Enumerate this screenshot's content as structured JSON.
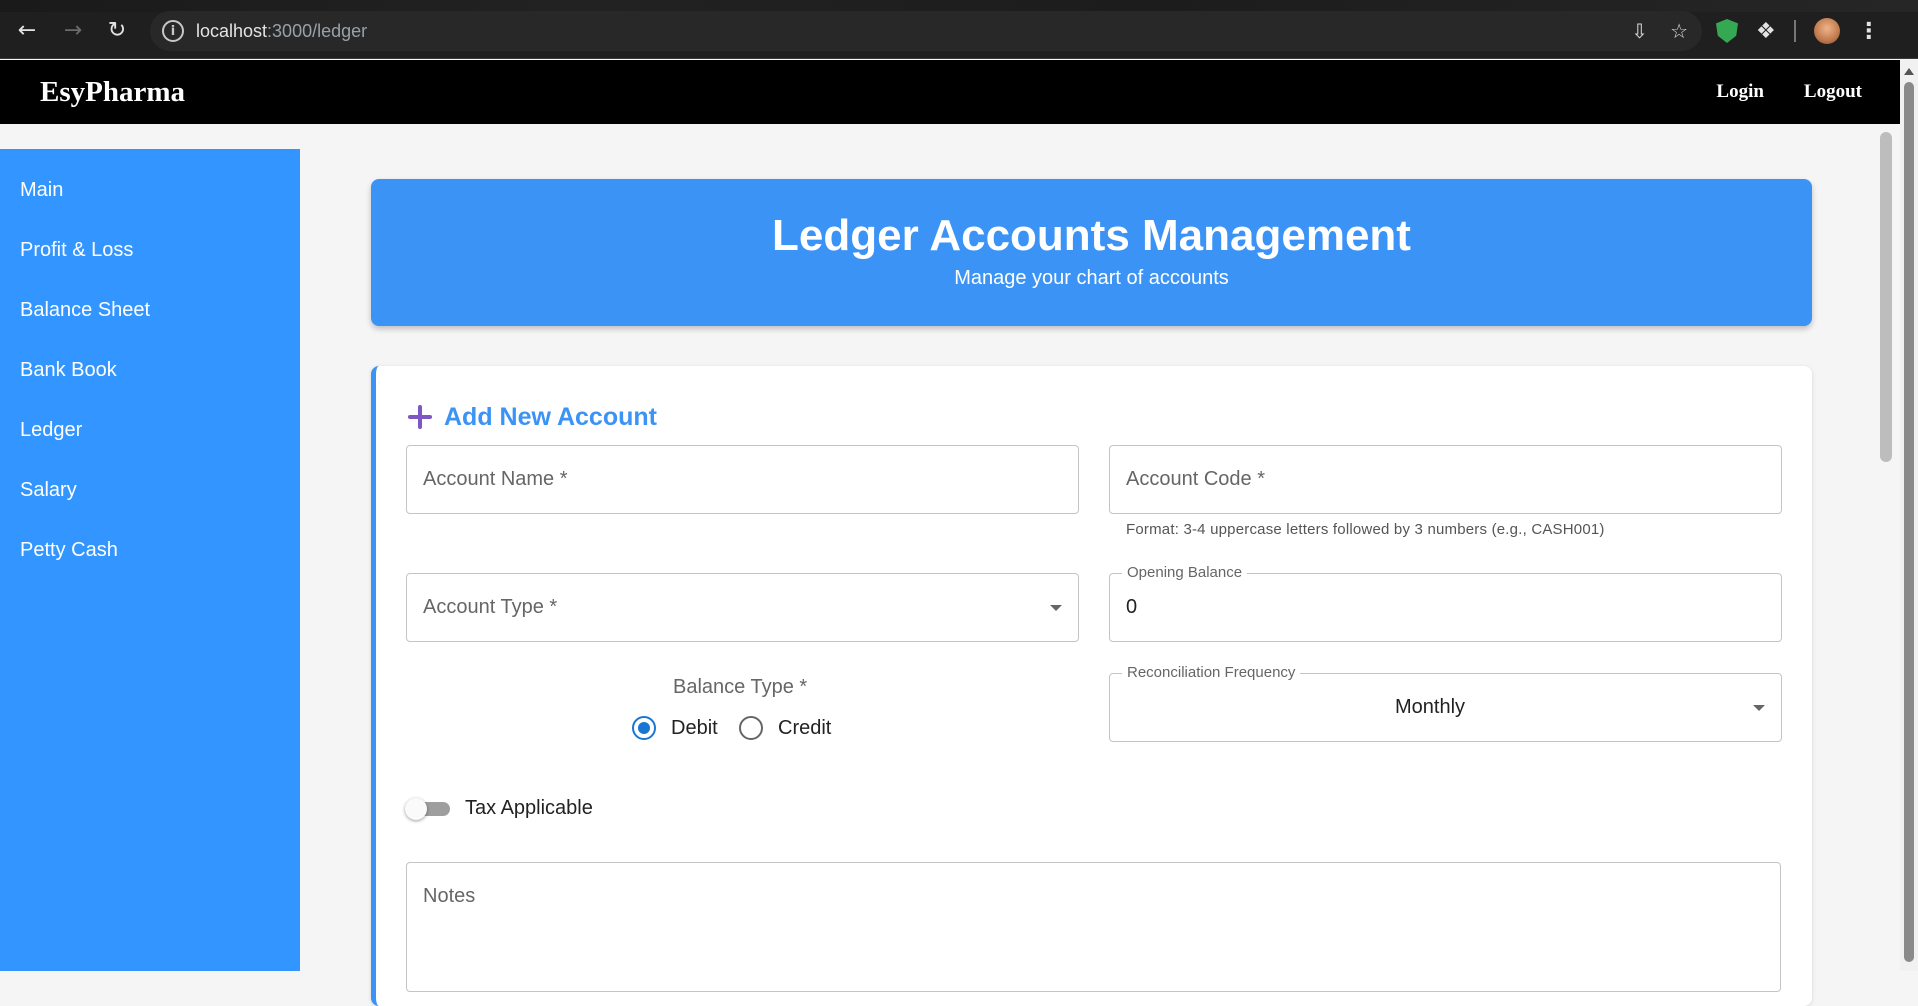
{
  "browser": {
    "url_host": "localhost",
    "url_rest": ":3000/ledger",
    "back_icon": "arrow-left-icon",
    "forward_icon": "arrow-right-icon",
    "reload_icon": "reload-icon"
  },
  "header": {
    "brand": "EsyPharma",
    "login": "Login",
    "logout": "Logout"
  },
  "sidebar": {
    "items": [
      {
        "label": "Main"
      },
      {
        "label": "Profit & Loss"
      },
      {
        "label": "Balance Sheet"
      },
      {
        "label": "Bank Book"
      },
      {
        "label": "Ledger"
      },
      {
        "label": "Salary"
      },
      {
        "label": "Petty Cash"
      }
    ]
  },
  "hero": {
    "title": "Ledger Accounts Management",
    "subtitle": "Manage your chart of accounts"
  },
  "form": {
    "section_title": "Add New Account",
    "account_name_placeholder": "Account Name *",
    "account_code_placeholder": "Account Code *",
    "account_code_helper": "Format: 3-4 uppercase letters followed by 3 numbers (e.g., CASH001)",
    "account_type_placeholder": "Account Type *",
    "opening_balance_label": "Opening Balance",
    "opening_balance_value": "0",
    "balance_type_label": "Balance Type *",
    "balance_type_options": [
      "Debit",
      "Credit"
    ],
    "balance_type_selected": "Debit",
    "reconciliation_label": "Reconciliation Frequency",
    "reconciliation_value": "Monthly",
    "tax_applicable_label": "Tax Applicable",
    "tax_applicable": false,
    "notes_placeholder": "Notes"
  },
  "colors": {
    "sidebar_bg": "#3395ff",
    "hero_bg": "#3b93f5",
    "accent_purple": "#7e57c2",
    "radio_checked": "#1976d2",
    "header_bg": "#000000"
  }
}
